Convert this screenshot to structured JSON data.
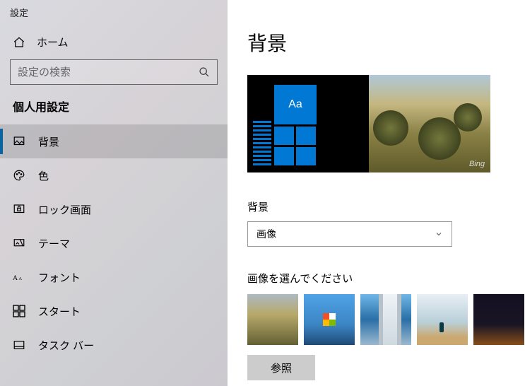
{
  "app_title": "設定",
  "home_label": "ホーム",
  "search_placeholder": "設定の検索",
  "category_label": "個人用設定",
  "sidebar": {
    "items": [
      {
        "label": "背景"
      },
      {
        "label": "色"
      },
      {
        "label": "ロック画面"
      },
      {
        "label": "テーマ"
      },
      {
        "label": "フォント"
      },
      {
        "label": "スタート"
      },
      {
        "label": "タスク バー"
      }
    ]
  },
  "page_title": "背景",
  "preview_tile_text": "Aa",
  "preview_watermark": "Bing",
  "bg_section_label": "背景",
  "bg_dropdown_value": "画像",
  "choose_label": "画像を選んでください",
  "browse_label": "参照"
}
